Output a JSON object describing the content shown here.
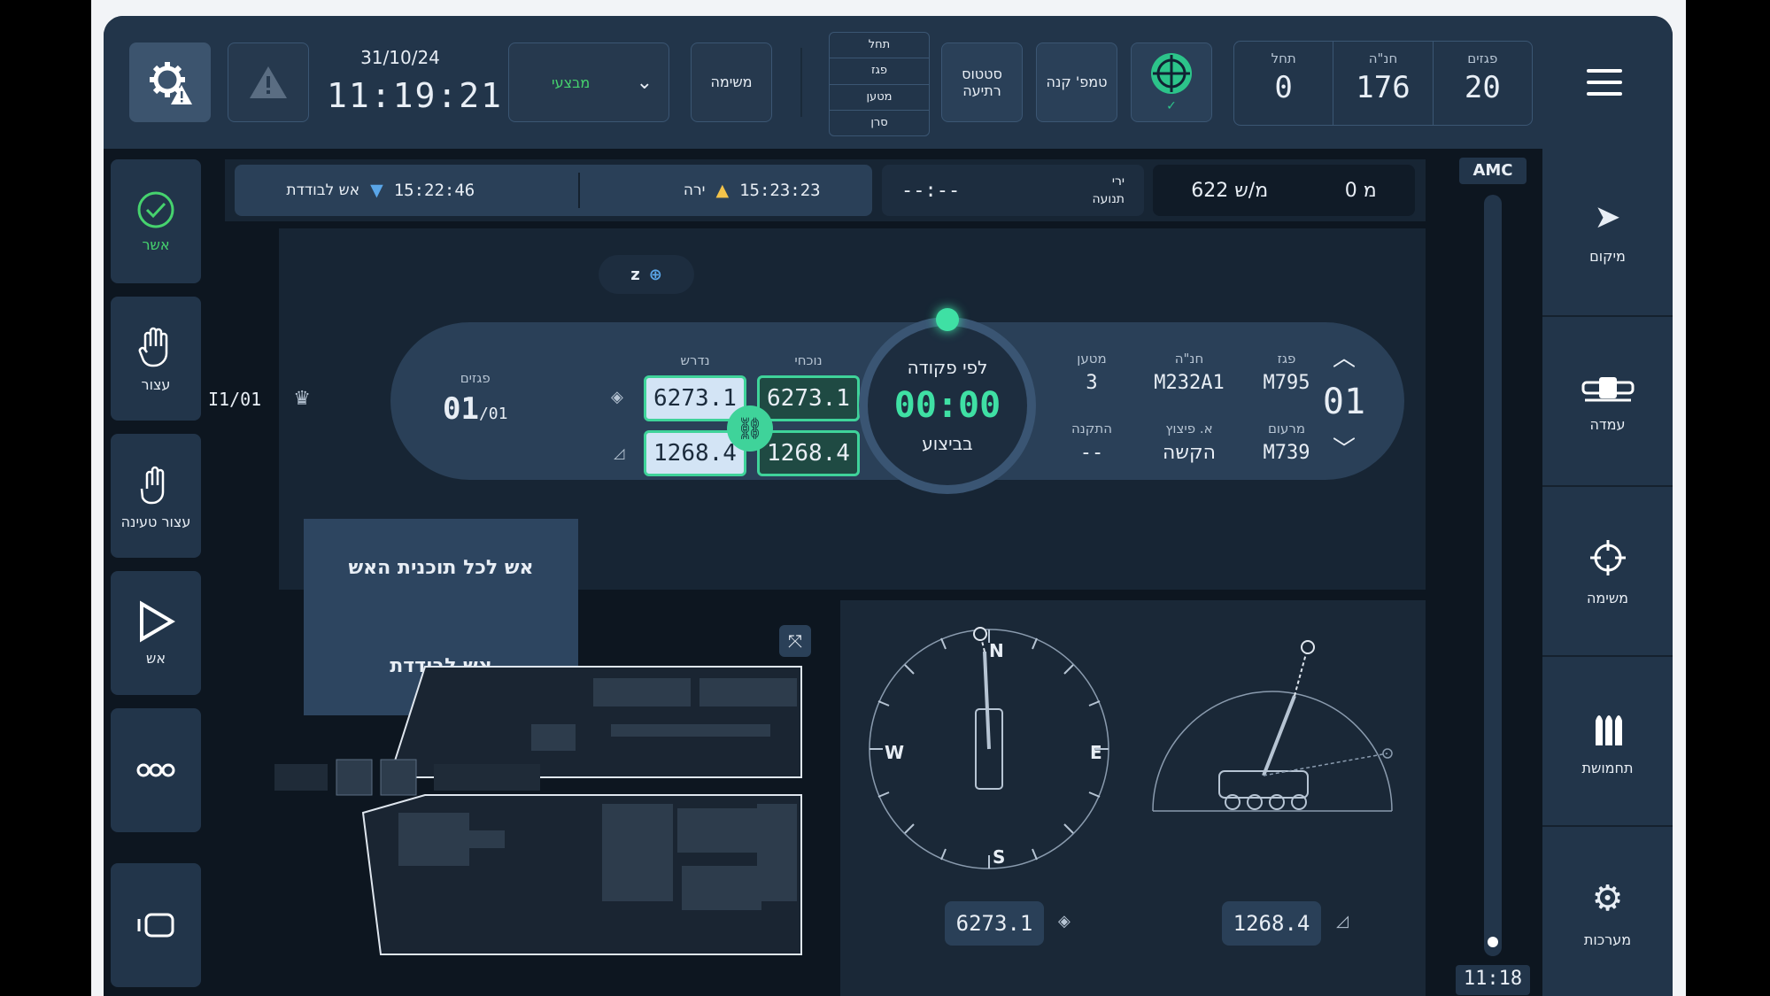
{
  "header": {
    "date": "31/10/24",
    "time": "11:19:21",
    "mode_value": "מבצעי",
    "mission_button": "משימה",
    "status_list": [
      "תחל",
      "פגז",
      "מטען",
      "סרן"
    ],
    "status_button": "סטטוס רתיעה",
    "barrel_temp_button": "טמפ' קנה",
    "counters": [
      {
        "label": "תחל",
        "value": "0"
      },
      {
        "label": "חנ\"ה",
        "value": "176"
      },
      {
        "label": "פגזים",
        "value": "20"
      }
    ]
  },
  "left_nav": {
    "approve": "אשר",
    "hold": "עצור",
    "hold_loading": "עצור טעינה",
    "fire": "אש"
  },
  "right_nav": {
    "location": "מיקום",
    "position": "עמדה",
    "mission": "משימה",
    "ammo": "תחמושת",
    "systems": "מערכות"
  },
  "status_strip": {
    "single_fire_label": "אש לבודדת",
    "single_fire_time": "15:22:46",
    "fire_label": "ירה",
    "fire_time": "15:23:23",
    "shots_label": "ירי",
    "motion_label": "תנועה",
    "dash_time": "--:--",
    "speed": "622 מ/ש",
    "meters": "0 מ"
  },
  "amc": {
    "label": "AMC",
    "time": "11:18"
  },
  "fire_panel": {
    "z_label": "z",
    "shells_label": "פגזים",
    "shells_count": "01",
    "shells_total": "/01",
    "side_count": "I1/01",
    "required_label": "נדרש",
    "current_label": "נוכחי",
    "azimuth_required": "6273.1",
    "azimuth_current": "6273.1",
    "elevation_required": "1268.4",
    "elevation_current": "1268.4",
    "command_label": "לפי פקודה",
    "timer": "00:00",
    "state": "בביצוע",
    "fields": [
      {
        "label": "מטען",
        "value": "3"
      },
      {
        "label": "חנ\"ה",
        "value": "M232A1"
      },
      {
        "label": "פגז",
        "value": "M795"
      },
      {
        "label": "התקנה",
        "value": "--"
      },
      {
        "label": "א. פיצוץ",
        "value": "הקשה"
      },
      {
        "label": "מרעום",
        "value": "M739"
      }
    ],
    "index": "01"
  },
  "popup": {
    "option1": "אש לכל תוכנית האש",
    "option2": "אש לבודדת"
  },
  "compass": {
    "n": "N",
    "e": "E",
    "s": "S",
    "w": "W",
    "azimuth_readout": "6273.1"
  },
  "elevation": {
    "readout": "1268.4"
  }
}
